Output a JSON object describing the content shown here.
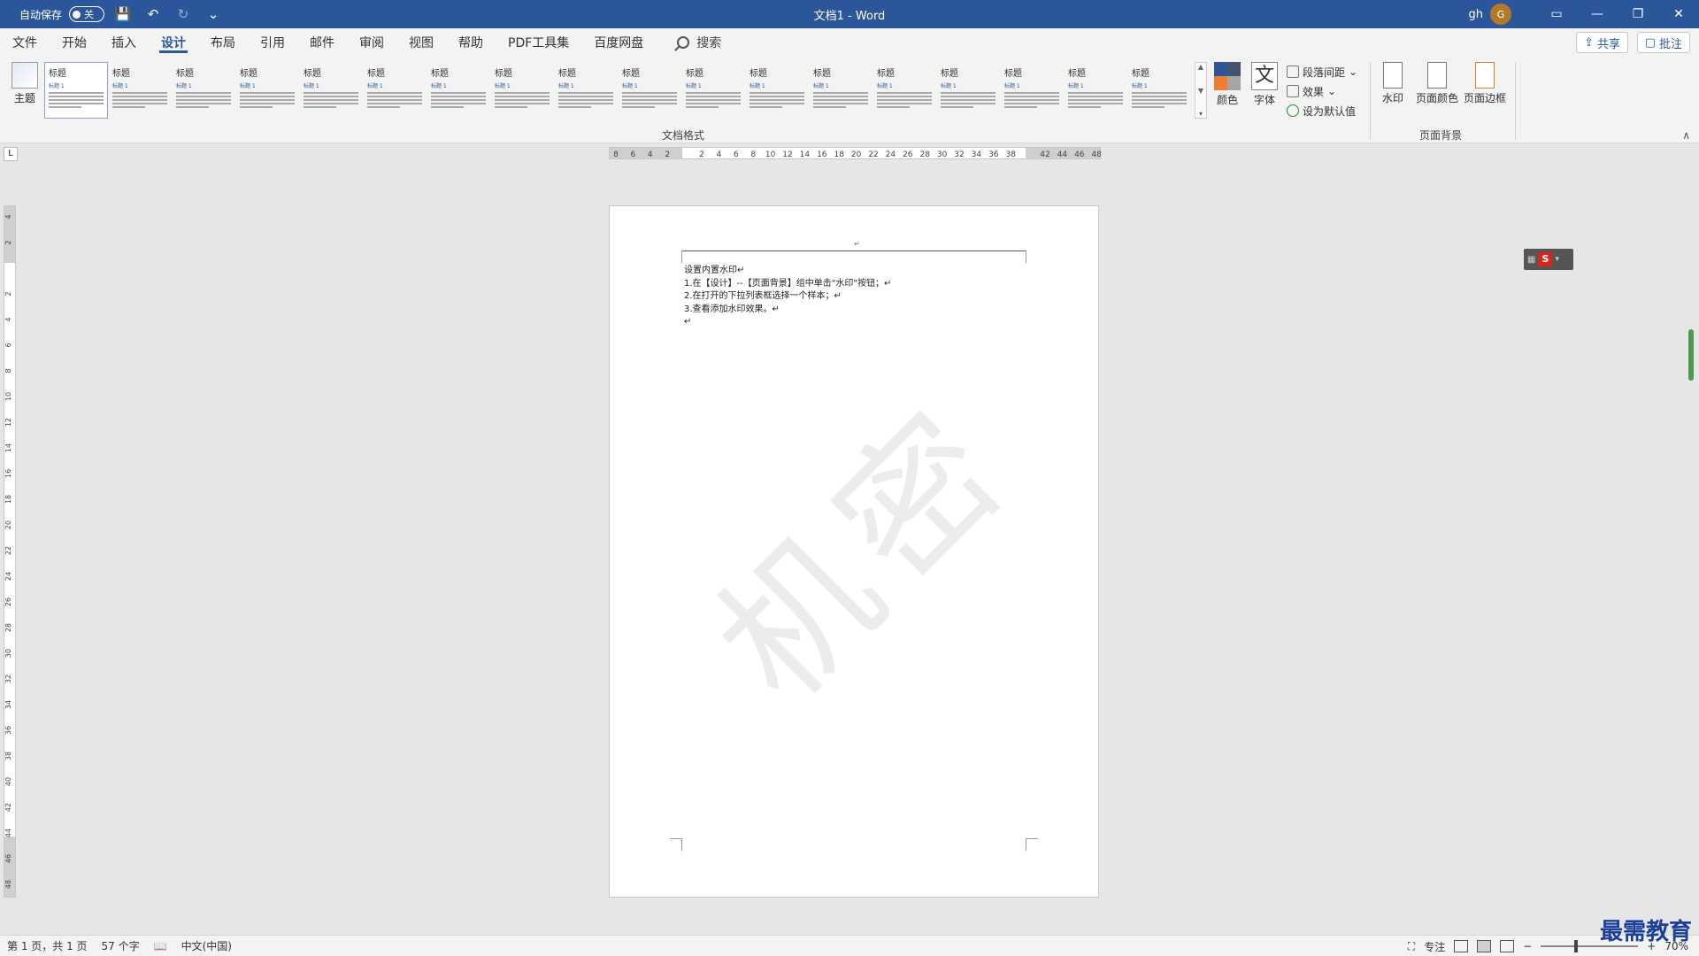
{
  "titlebar": {
    "autosave_label": "自动保存",
    "autosave_state": "关",
    "doc_title": "文档1  -  Word",
    "user_name": "gh",
    "user_initial": "G"
  },
  "tabs": [
    "文件",
    "开始",
    "插入",
    "设计",
    "布局",
    "引用",
    "邮件",
    "审阅",
    "视图",
    "帮助",
    "PDF工具集",
    "百度网盘"
  ],
  "active_tab": "设计",
  "search_label": "搜索",
  "share_label": "共享",
  "comment_label": "批注",
  "ribbon": {
    "theme_label": "主题",
    "style_thumbs": [
      {
        "t1": "标题",
        "t2": "标题 1"
      },
      {
        "t1": "标题",
        "t2": "标题 1"
      },
      {
        "t1": "标题",
        "t2": "标题 1"
      },
      {
        "t1": "标题",
        "t2": "标题 1"
      },
      {
        "t1": "标题",
        "t2": "标题 1"
      },
      {
        "t1": "标题",
        "t2": "标题 1"
      },
      {
        "t1": "标题",
        "t2": "标题 1"
      },
      {
        "t1": "标题",
        "t2": "标题 1"
      },
      {
        "t1": "标题",
        "t2": "标题 1"
      },
      {
        "t1": "标题",
        "t2": "标题 1"
      },
      {
        "t1": "标题",
        "t2": "标题 1"
      },
      {
        "t1": "标题",
        "t2": "标题 1"
      },
      {
        "t1": "标题",
        "t2": "标题 1"
      },
      {
        "t1": "标题",
        "t2": "标题 1"
      },
      {
        "t1": "标题",
        "t2": "标题 1"
      },
      {
        "t1": "标题",
        "t2": "标题 1"
      },
      {
        "t1": "标题",
        "t2": "标题 1"
      },
      {
        "t1": "标题",
        "t2": "标题 1"
      }
    ],
    "doc_format_group": "文档格式",
    "colors_label": "颜色",
    "fonts_label": "字体",
    "fonts_glyph": "文",
    "paragraph_spacing": "段落间距",
    "effects": "效果",
    "set_default": "设为默认值",
    "watermark_label": "水印",
    "page_color_label": "页面颜色",
    "page_border_label": "页面边框",
    "page_background_group": "页面背景"
  },
  "ruler": {
    "corner": "L",
    "h_ticks": [
      "8",
      "6",
      "4",
      "2",
      "",
      "2",
      "4",
      "6",
      "8",
      "10",
      "12",
      "14",
      "16",
      "18",
      "20",
      "22",
      "24",
      "26",
      "28",
      "30",
      "32",
      "34",
      "36",
      "38",
      "",
      "42",
      "44",
      "46",
      "48"
    ],
    "v_ticks": [
      "4",
      "2",
      "",
      "2",
      "4",
      "6",
      "8",
      "10",
      "12",
      "14",
      "16",
      "18",
      "20",
      "22",
      "24",
      "26",
      "28",
      "30",
      "32",
      "34",
      "36",
      "38",
      "40",
      "42",
      "44",
      "46",
      "48"
    ]
  },
  "document": {
    "header_mark": "↵",
    "lines": [
      "设置内置水印↵",
      "1.在【设计】--【页面背景】组中单击\"水印\"按钮；↵",
      "2.在打开的下拉列表框选择一个样本；↵",
      "3.查看添加水印效果。↵",
      "↵"
    ],
    "watermark_text": "机密"
  },
  "ime": {
    "letter": "S"
  },
  "status": {
    "page": "第 1 页，共 1 页",
    "words": "57 个字",
    "language": "中文(中国)",
    "focus": "专注",
    "zoom": "70%"
  },
  "brand": "最需教育",
  "colors": {
    "title_bar": "#2b579a",
    "accent": "#2b579a",
    "theme_colors": [
      "#2f5597",
      "#ed7d31",
      "#44546a",
      "#a5a5a5"
    ]
  }
}
